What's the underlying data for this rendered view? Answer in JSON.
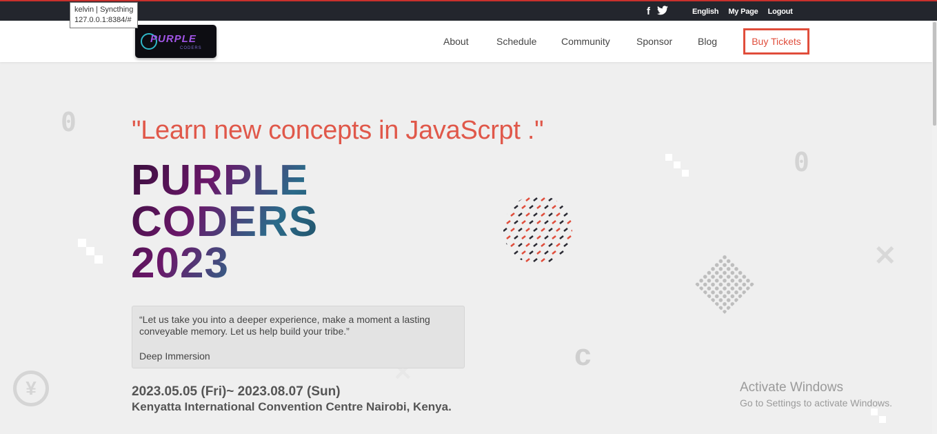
{
  "tooltip": {
    "line1": "kelvin | Syncthing",
    "line2": "127.0.0.1:8384/#"
  },
  "topbar": {
    "social": [
      {
        "icon": "facebook-icon",
        "glyph": "f"
      },
      {
        "icon": "twitter-icon",
        "glyph": "🐦"
      }
    ],
    "links": [
      "English",
      "My Page",
      "Logout"
    ]
  },
  "logo": {
    "text": "PURPLE",
    "subtext": "CODERS"
  },
  "nav": {
    "about": "About",
    "schedule": "Schedule",
    "community": "Community",
    "sponsor": "Sponsor",
    "blog": "Blog",
    "buy": "Buy Tickets"
  },
  "hero": {
    "tagline": "\"Learn new concepts in JavaScrpt .\"",
    "title_line1": "PURPLE",
    "title_line2": "CODERS",
    "title_line3": "2023",
    "quote": "“Let us take you into a deeper experience, make a moment a lasting conveyable memory. Let us help build your tribe.”",
    "quote_author": "Deep Immersion",
    "date": "2023.05.05 (Fri)~ 2023.08.07 (Sun)",
    "venue": "Kenyatta International Convention Centre Nairobi, Kenya."
  },
  "decor": {
    "zero_a": "0",
    "zero_b": "0",
    "c_glyph": "c",
    "x_glyph": "✕",
    "yen_glyph": "¥"
  },
  "watermark": {
    "title": "Activate Windows",
    "subtitle": "Go to Settings to activate Windows."
  },
  "colors": {
    "accent": "#e04d3b",
    "topbar": "#23262d",
    "purple": "#6a1769"
  }
}
